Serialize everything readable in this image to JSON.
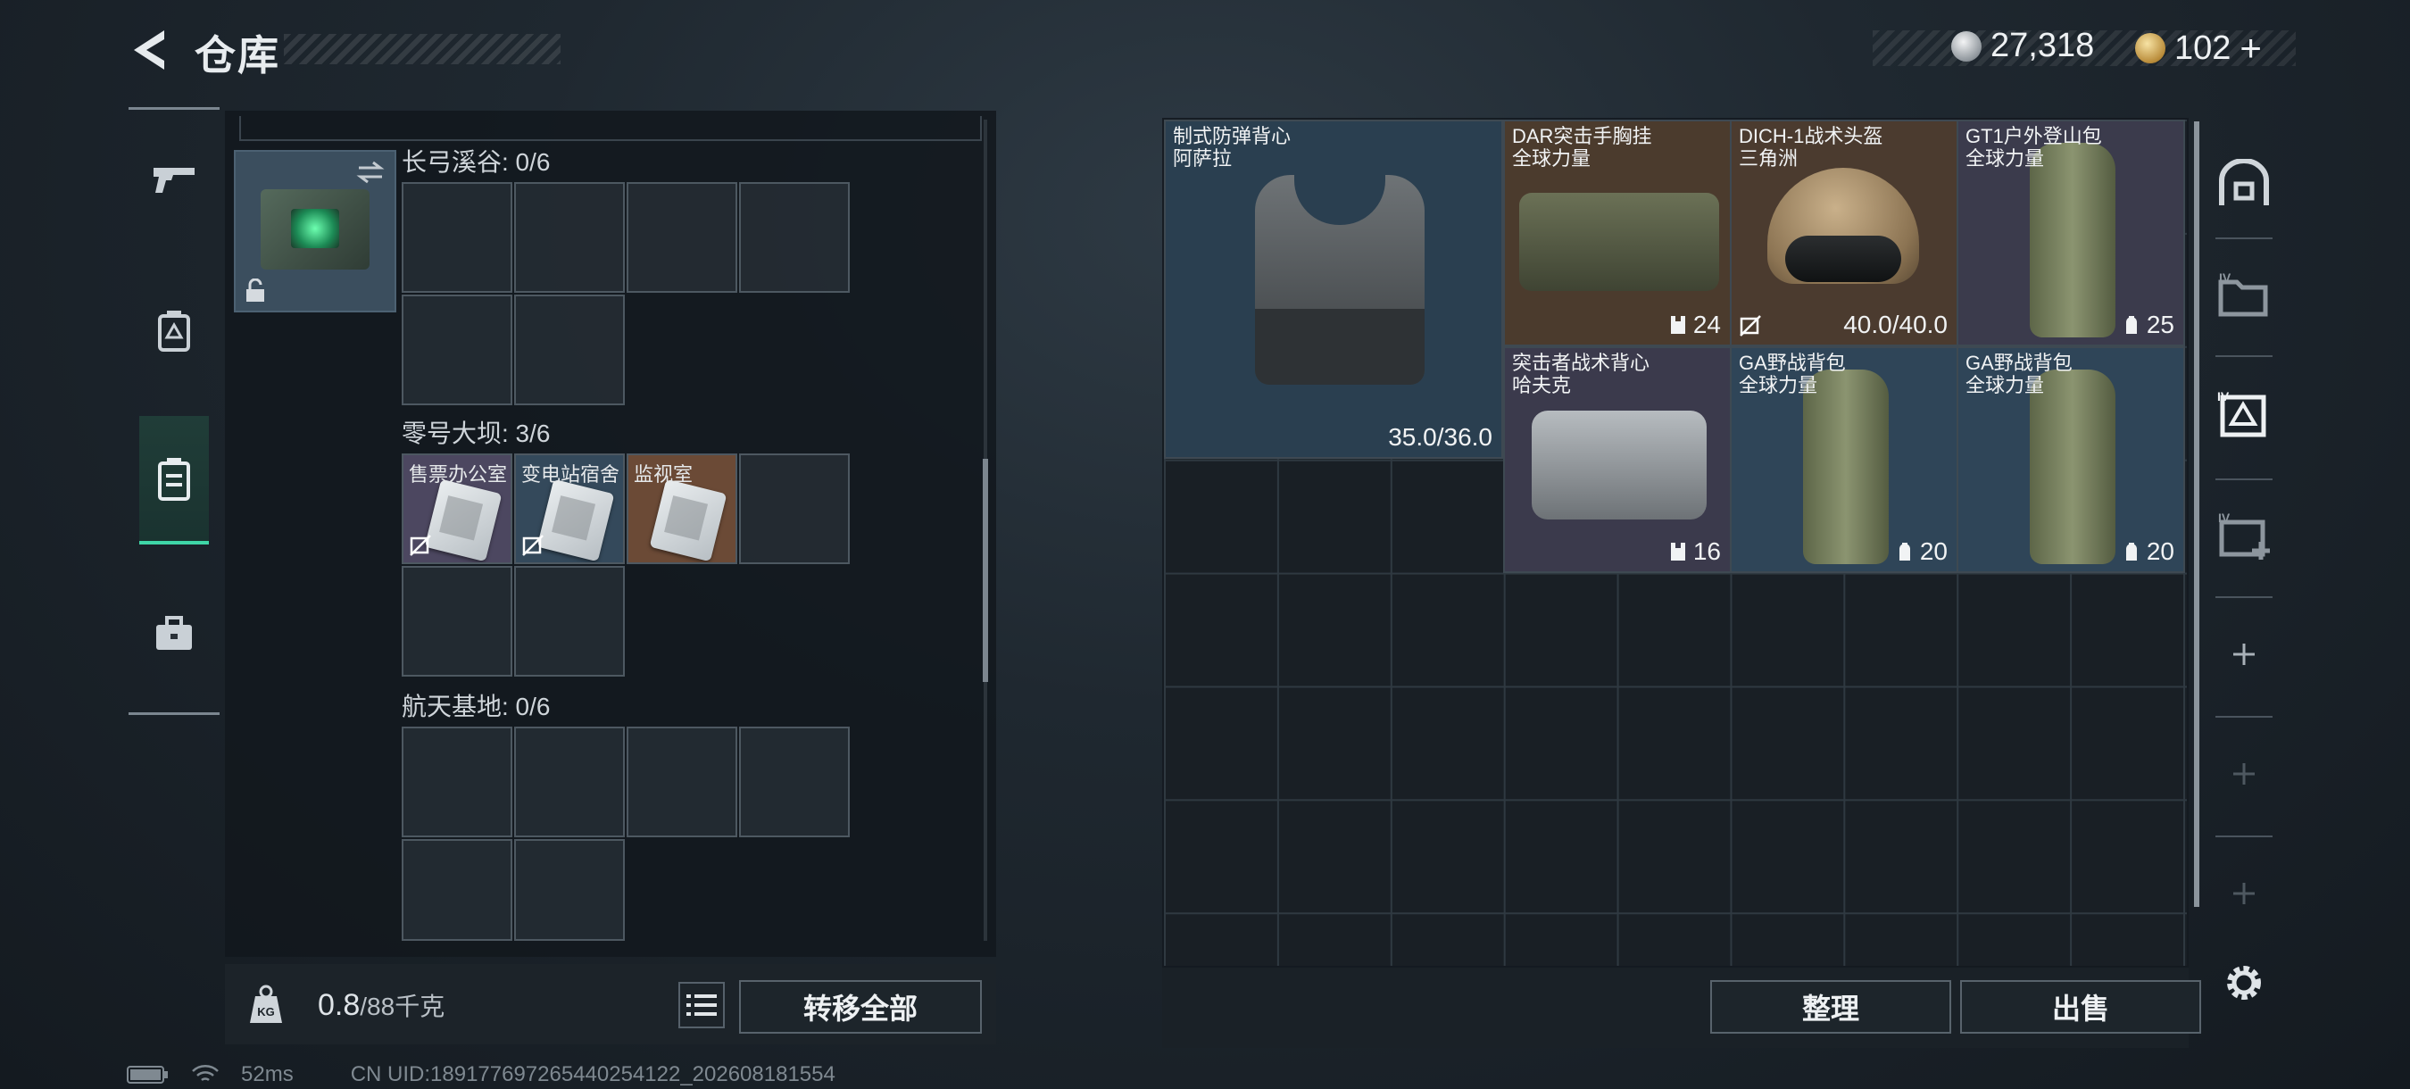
{
  "header": {
    "title": "仓库",
    "currency_a": "27,318",
    "currency_b": "102",
    "currency_b_add": "+"
  },
  "left_tabs": [
    {
      "name": "weapon",
      "icon": "pistol-icon"
    },
    {
      "name": "armor",
      "icon": "armor-case-icon"
    },
    {
      "name": "keys",
      "icon": "keycard-case-icon",
      "active": true
    },
    {
      "name": "toolbox",
      "icon": "toolbox-icon"
    }
  ],
  "key_container": {
    "maps": [
      {
        "label": "长弓溪谷: 0/6",
        "items": []
      },
      {
        "label": "零号大坝: 3/6",
        "items": [
          {
            "name": "售票办公室",
            "bg": "#4c4760"
          },
          {
            "name": "变电站宿舍",
            "bg": "#34495b"
          },
          {
            "name": "监视室",
            "bg": "#6b4a36"
          }
        ]
      },
      {
        "label": "航天基地: 0/6",
        "items": []
      }
    ]
  },
  "left_footer": {
    "weight_value": "0.8",
    "weight_max": "/88千克",
    "transfer_all": "转移全部"
  },
  "stash_items": [
    {
      "name1": "制式防弹背心",
      "name2": "阿萨拉",
      "value": "35.0/36.0",
      "icon": "",
      "bg": "#2a3f50"
    },
    {
      "name1": "DAR突击手胸挂",
      "name2": "全球力量",
      "value": "24",
      "icon": "chest-rig-icon",
      "bg": "#4b3b2d"
    },
    {
      "name1": "DICH-1战术头盔",
      "name2": "三角洲",
      "value": "40.0/40.0",
      "icon": "no-insure-icon",
      "bg": "#4b3b2f"
    },
    {
      "name1": "GT1户外登山包",
      "name2": "全球力量",
      "value": "25",
      "icon": "backpack-icon",
      "bg": "#3b3b4c"
    },
    {
      "name1": "突击者战术背心",
      "name2": "哈夫克",
      "value": "16",
      "icon": "chest-rig-icon",
      "bg": "#3b3a4c"
    },
    {
      "name1": "GA野战背包",
      "name2": "全球力量",
      "value": "20",
      "icon": "backpack-icon",
      "bg": "#2f4558"
    },
    {
      "name1": "GA野战背包",
      "name2": "全球力量",
      "value": "20",
      "icon": "backpack-icon",
      "bg": "#2f4558"
    }
  ],
  "right_footer": {
    "sort": "整理",
    "sell": "出售"
  },
  "status": {
    "ping": "52ms",
    "uid": "CN UID:189177697265440254122_202608181554"
  }
}
